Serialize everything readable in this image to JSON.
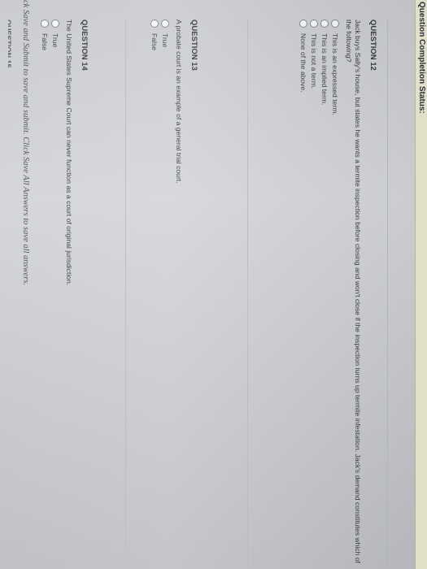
{
  "header": {
    "status_label": "Question Completion Status:"
  },
  "questions": [
    {
      "title": "QUESTION 12",
      "text": "Jack buys Sally's house, but states he wants a termite inspection before closing and won't close if the inspection turns up termite infestation. Jack's demand constitutes which of the following?",
      "options": [
        "This is an expressed term.",
        "This is an implied term.",
        "This is not a term.",
        "None of the above."
      ]
    },
    {
      "title": "QUESTION 13",
      "text": "A probate court is an example of a general trial court.",
      "options": [
        "True",
        "False"
      ]
    },
    {
      "title": "QUESTION 14",
      "text": "The United States Supreme Court can never function as a court of original jurisdiction.",
      "options": [
        "True",
        "False"
      ]
    }
  ],
  "footer": {
    "instruction": "ck Save and Submit to save and submit. Click Save All Answers to save all answers.",
    "next_heading": "QUESTION 15"
  }
}
